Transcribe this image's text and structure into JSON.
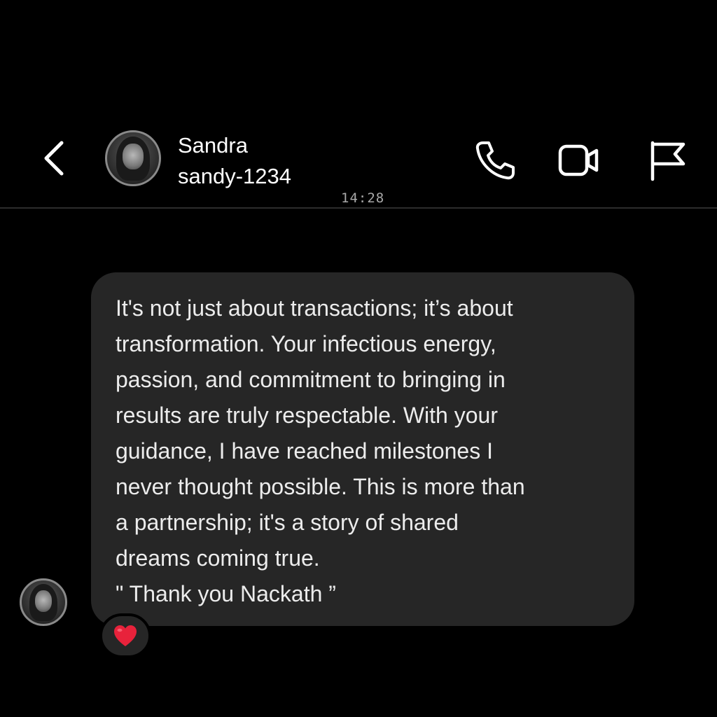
{
  "header": {
    "contact_name": "Sandra",
    "contact_username": "sandy-1234",
    "icons": {
      "back": "chevron-left-icon",
      "call": "phone-icon",
      "video": "video-camera-icon",
      "report": "flag-icon"
    }
  },
  "conversation": {
    "timestamp": "14:28",
    "message": {
      "lines": [
        "It's not just about transactions; it’s about",
        "transformation. Your infectious energy,",
        "passion, and commitment to bringing in",
        "results are truly respectable. With your",
        "guidance, I have reached milestones I",
        "never thought possible. This is more than",
        "a partnership; it's a story of shared",
        "dreams coming true.",
        "\" Thank you Nackath ”"
      ],
      "reaction": "❤️"
    }
  },
  "colors": {
    "background": "#000000",
    "bubble": "#262626",
    "text": "#ececec",
    "timestamp": "#a9a9a9",
    "heart": "#e8223b"
  }
}
